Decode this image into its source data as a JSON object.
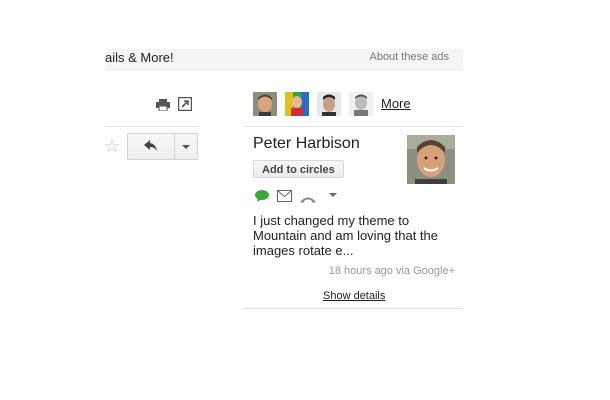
{
  "ads": {
    "text": "ails & More!",
    "about_label": "About these ads"
  },
  "toolbar": {
    "print_icon": "print-icon",
    "popout_icon": "open-in-new-window-icon",
    "star_icon": "star-icon",
    "reply_icon": "reply-arrow-icon",
    "more_icon": "chevron-down-icon"
  },
  "people": {
    "avatar_names": [
      "person-avatar-1",
      "person-avatar-2",
      "person-avatar-3",
      "person-avatar-4"
    ],
    "more_label": "More"
  },
  "profile": {
    "name": "Peter Harbison",
    "add_to_circles_label": "Add to circles",
    "action_icons": [
      "chat-icon",
      "mail-icon",
      "phone-icon",
      "chevron-down-icon"
    ],
    "post_text": "I just changed my theme to Mountain and am loving that the images rotate e...",
    "post_meta": "18 hours ago via Google+",
    "show_details_label": "Show details"
  },
  "colors": {
    "chat_green": "#3fa63f",
    "ad_background": "#f5f5f5",
    "divider": "#e5e5e5"
  }
}
